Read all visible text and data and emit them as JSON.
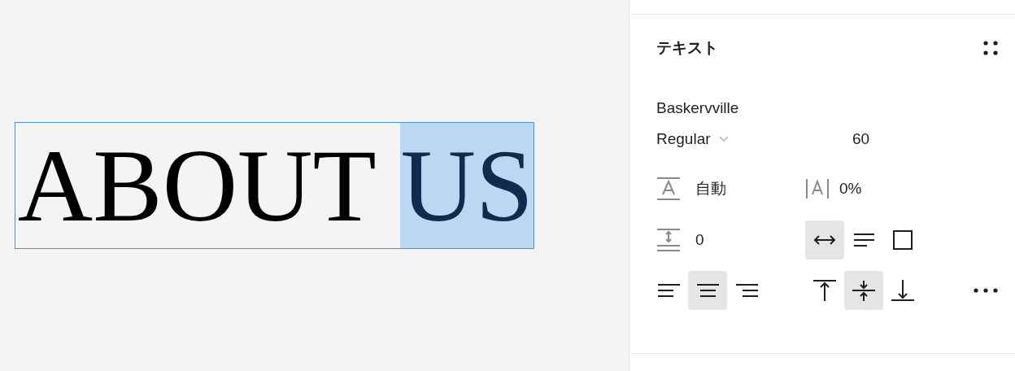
{
  "canvas": {
    "text_layer": {
      "segments": [
        {
          "text": "ABOUT ",
          "selected": false
        },
        {
          "text": "US",
          "selected": true
        }
      ]
    }
  },
  "panel": {
    "title": "テキスト",
    "font_family": "Baskervville",
    "font_style": "Regular",
    "font_size": "60",
    "line_height": "自動",
    "letter_spacing": "0%",
    "paragraph_spacing": "0",
    "resize_options": [
      {
        "kind": "auto-width",
        "selected": true
      },
      {
        "kind": "auto-height",
        "selected": false
      },
      {
        "kind": "fixed",
        "selected": false
      }
    ],
    "align_horizontal": [
      {
        "kind": "left",
        "selected": false
      },
      {
        "kind": "center",
        "selected": true
      },
      {
        "kind": "right",
        "selected": false
      }
    ],
    "align_vertical": [
      {
        "kind": "top",
        "selected": false
      },
      {
        "kind": "middle",
        "selected": true
      },
      {
        "kind": "bottom",
        "selected": false
      }
    ]
  }
}
